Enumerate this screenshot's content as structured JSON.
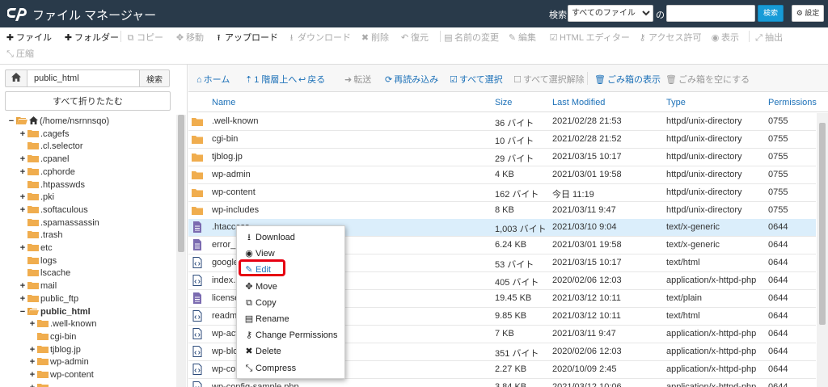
{
  "header": {
    "title": "ファイル マネージャー",
    "search_label": "検索",
    "search_scope": "すべてのファイル",
    "search_of": "の",
    "search_input": "",
    "search_button": "検索",
    "settings_button": "設定"
  },
  "toolbar": {
    "items": [
      {
        "label": "ファイル",
        "icon": "plus-icon",
        "enabled": true
      },
      {
        "label": "フォルダー",
        "icon": "plus-icon",
        "enabled": true
      },
      {
        "label": "コピー",
        "icon": "copy-icon",
        "enabled": false
      },
      {
        "label": "移動",
        "icon": "move-icon",
        "enabled": false
      },
      {
        "label": "アップロード",
        "icon": "upload-icon",
        "enabled": true
      },
      {
        "label": "ダウンロード",
        "icon": "download-icon",
        "enabled": false
      },
      {
        "label": "削除",
        "icon": "times-icon",
        "enabled": false
      },
      {
        "label": "復元",
        "icon": "undo-icon",
        "enabled": false
      },
      {
        "label": "名前の変更",
        "icon": "file-icon",
        "enabled": false
      },
      {
        "label": "編集",
        "icon": "pencil-icon",
        "enabled": false
      },
      {
        "label": "HTML エディター",
        "icon": "html-editor-icon",
        "enabled": false
      },
      {
        "label": "アクセス許可",
        "icon": "key-icon",
        "enabled": false
      },
      {
        "label": "表示",
        "icon": "eye-icon",
        "enabled": false
      },
      {
        "label": "抽出",
        "icon": "expand-icon",
        "enabled": false
      },
      {
        "label": "圧縮",
        "icon": "compress-icon",
        "enabled": false
      }
    ]
  },
  "left": {
    "path_value": "public_html",
    "go_button": "検索",
    "collapse_all": "すべて折りたたむ",
    "tree": [
      {
        "label": "(/home/nsrnnsqo)",
        "exp": "−",
        "indent": 0,
        "home": true,
        "open": true,
        "bold": false
      },
      {
        "label": ".cagefs",
        "exp": "+",
        "indent": 1,
        "bold": false
      },
      {
        "label": ".cl.selector",
        "exp": "",
        "indent": 1,
        "bold": false
      },
      {
        "label": ".cpanel",
        "exp": "+",
        "indent": 1,
        "bold": false
      },
      {
        "label": ".cphorde",
        "exp": "+",
        "indent": 1,
        "bold": false
      },
      {
        "label": ".htpasswds",
        "exp": "",
        "indent": 1,
        "bold": false
      },
      {
        "label": ".pki",
        "exp": "+",
        "indent": 1,
        "bold": false
      },
      {
        "label": ".softaculous",
        "exp": "+",
        "indent": 1,
        "bold": false
      },
      {
        "label": ".spamassassin",
        "exp": "",
        "indent": 1,
        "bold": false
      },
      {
        "label": ".trash",
        "exp": "",
        "indent": 1,
        "bold": false
      },
      {
        "label": "etc",
        "exp": "+",
        "indent": 1,
        "bold": false
      },
      {
        "label": "logs",
        "exp": "",
        "indent": 1,
        "bold": false
      },
      {
        "label": "lscache",
        "exp": "",
        "indent": 1,
        "bold": false
      },
      {
        "label": "mail",
        "exp": "+",
        "indent": 1,
        "bold": false
      },
      {
        "label": "public_ftp",
        "exp": "+",
        "indent": 1,
        "bold": false
      },
      {
        "label": "public_html",
        "exp": "−",
        "indent": 1,
        "open": true,
        "bold": true
      },
      {
        "label": ".well-known",
        "exp": "+",
        "indent": 2,
        "bold": false
      },
      {
        "label": "cgi-bin",
        "exp": "",
        "indent": 2,
        "bold": false
      },
      {
        "label": "tjblog.jp",
        "exp": "+",
        "indent": 2,
        "bold": false
      },
      {
        "label": "wp-admin",
        "exp": "+",
        "indent": 2,
        "bold": false
      },
      {
        "label": "wp-content",
        "exp": "+",
        "indent": 2,
        "bold": false
      },
      {
        "label": "",
        "exp": "+",
        "indent": 2,
        "bold": false
      }
    ]
  },
  "navbar": {
    "items": [
      {
        "label": "ホーム",
        "icon": "home-icon",
        "enabled": true
      },
      {
        "label": "1 階層上へ",
        "icon": "level-up-icon",
        "enabled": true
      },
      {
        "label": "戻る",
        "icon": "back-icon",
        "enabled": true
      },
      {
        "label": "転送",
        "icon": "forward-icon",
        "enabled": false
      },
      {
        "label": "再読み込み",
        "icon": "reload-icon",
        "enabled": true
      },
      {
        "label": "すべて選択",
        "icon": "checkbox-checked-icon",
        "enabled": true
      },
      {
        "label": "すべて選択解除",
        "icon": "checkbox-empty-icon",
        "enabled": false
      },
      {
        "label": "ごみ箱の表示",
        "icon": "trash-icon",
        "enabled": true
      },
      {
        "label": "ごみ箱を空にする",
        "icon": "trash-icon",
        "enabled": false
      }
    ]
  },
  "table": {
    "headers": {
      "name": "Name",
      "size": "Size",
      "modified": "Last Modified",
      "type": "Type",
      "perms": "Permissions"
    },
    "rows": [
      {
        "name": ".well-known",
        "size": "36 バイト",
        "modified": "2021/02/28 21:53",
        "type": "httpd/unix-directory",
        "perms": "0755",
        "kind": "folder"
      },
      {
        "name": "cgi-bin",
        "size": "10 バイト",
        "modified": "2021/02/28 21:52",
        "type": "httpd/unix-directory",
        "perms": "0755",
        "kind": "folder"
      },
      {
        "name": "tjblog.jp",
        "size": "29 バイト",
        "modified": "2021/03/15 10:17",
        "type": "httpd/unix-directory",
        "perms": "0755",
        "kind": "folder"
      },
      {
        "name": "wp-admin",
        "size": "4 KB",
        "modified": "2021/03/01 19:58",
        "type": "httpd/unix-directory",
        "perms": "0755",
        "kind": "folder"
      },
      {
        "name": "wp-content",
        "size": "162 バイト",
        "modified": "今日 11:19",
        "type": "httpd/unix-directory",
        "perms": "0755",
        "kind": "folder"
      },
      {
        "name": "wp-includes",
        "size": "8 KB",
        "modified": "2021/03/11 9:47",
        "type": "httpd/unix-directory",
        "perms": "0755",
        "kind": "folder"
      },
      {
        "name": ".htaccess",
        "size": "1,003 バイト",
        "modified": "2021/03/10 9:04",
        "type": "text/x-generic",
        "perms": "0644",
        "kind": "text",
        "selected": true
      },
      {
        "name": "error_lo",
        "size": "6.24 KB",
        "modified": "2021/03/01 19:58",
        "type": "text/x-generic",
        "perms": "0644",
        "kind": "text"
      },
      {
        "name": "google",
        "size": "53 バイト",
        "modified": "2021/03/15 10:17",
        "type": "text/html",
        "perms": "0644",
        "kind": "code"
      },
      {
        "name": "index.p",
        "size": "405 バイト",
        "modified": "2020/02/06 12:03",
        "type": "application/x-httpd-php",
        "perms": "0644",
        "kind": "code"
      },
      {
        "name": "license",
        "size": "19.45 KB",
        "modified": "2021/03/12 10:11",
        "type": "text/plain",
        "perms": "0644",
        "kind": "text"
      },
      {
        "name": "readme",
        "size": "9.85 KB",
        "modified": "2021/03/12 10:11",
        "type": "text/html",
        "perms": "0644",
        "kind": "code"
      },
      {
        "name": "wp-acti",
        "size": "7 KB",
        "modified": "2021/03/11 9:47",
        "type": "application/x-httpd-php",
        "perms": "0644",
        "kind": "code"
      },
      {
        "name": "wp-blog",
        "size": "351 バイト",
        "modified": "2020/02/06 12:03",
        "type": "application/x-httpd-php",
        "perms": "0644",
        "kind": "code"
      },
      {
        "name": "wp-com",
        "size": "2.27 KB",
        "modified": "2020/10/09 2:45",
        "type": "application/x-httpd-php",
        "perms": "0644",
        "kind": "code"
      },
      {
        "name": "wp-config-sample.php",
        "size": "3.84 KB",
        "modified": "2021/03/12 10:06",
        "type": "application/x-httpd-php",
        "perms": "0644",
        "kind": "code"
      }
    ]
  },
  "context_menu": {
    "items": [
      {
        "label": "Download",
        "icon": "download-icon"
      },
      {
        "label": "View",
        "icon": "eye-icon"
      },
      {
        "label": "Edit",
        "icon": "pencil-icon",
        "highlighted": true
      },
      {
        "label": "Move",
        "icon": "move-icon"
      },
      {
        "label": "Copy",
        "icon": "copy-icon"
      },
      {
        "label": "Rename",
        "icon": "file-icon"
      },
      {
        "label": "Change Permissions",
        "icon": "key-icon"
      },
      {
        "label": "Delete",
        "icon": "times-icon"
      },
      {
        "label": "Compress",
        "icon": "compress-icon"
      }
    ]
  },
  "colors": {
    "header_bg": "#293a4a",
    "link": "#1d71b8",
    "folder": "#f0ad4e",
    "selected_row": "#dbeefb",
    "highlight_outline": "#e60012",
    "search_button": "#179bd7"
  }
}
